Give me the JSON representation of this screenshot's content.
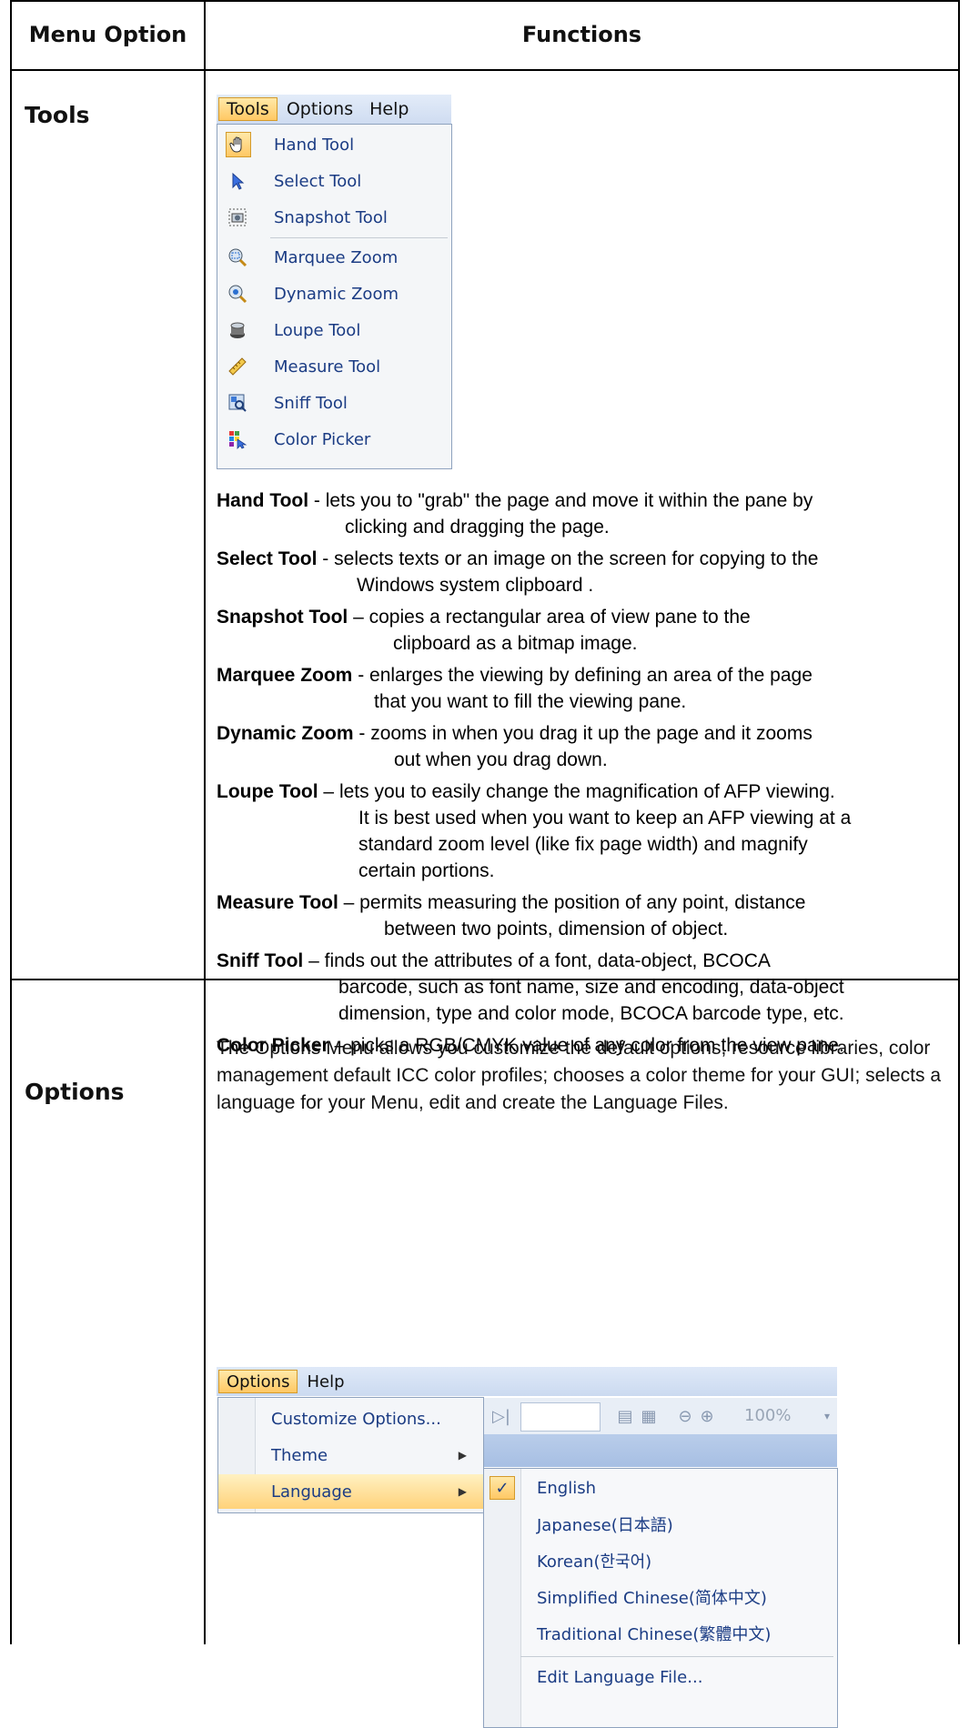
{
  "header": {
    "col1": "Menu Option",
    "col2": "Functions"
  },
  "tools_row": {
    "label": "Tools",
    "menubar": [
      "Tools",
      "Options",
      "Help"
    ],
    "menu_items": [
      {
        "label": "Hand Tool",
        "icon": "hand-icon"
      },
      {
        "label": "Select Tool",
        "icon": "pointer-arrow-icon"
      },
      {
        "label": "Snapshot Tool",
        "icon": "camera-icon"
      },
      {
        "label": "Marquee Zoom",
        "icon": "marquee-zoom-icon"
      },
      {
        "label": "Dynamic Zoom",
        "icon": "dynamic-zoom-icon"
      },
      {
        "label": "Loupe Tool",
        "icon": "loupe-icon"
      },
      {
        "label": "Measure Tool",
        "icon": "ruler-icon"
      },
      {
        "label": "Sniff Tool",
        "icon": "sniff-icon"
      },
      {
        "label": "Color Picker",
        "icon": "color-picker-icon"
      }
    ],
    "descriptions": [
      {
        "term": "Hand Tool",
        "sep": " - ",
        "lines": [
          "lets you to \"grab\" the page and move it within the pane by",
          "clicking and dragging the page."
        ]
      },
      {
        "term": "Select Tool",
        "sep": " - ",
        "lines": [
          "selects texts or an image on the screen for copying to the",
          "Windows system clipboard ."
        ]
      },
      {
        "term": "Snapshot Tool",
        "sep": " – ",
        "lines": [
          "copies a rectangular area of view pane to the",
          "clipboard as a bitmap image."
        ]
      },
      {
        "term": "Marquee Zoom",
        "sep": " - ",
        "lines": [
          "enlarges the viewing by defining an area of the page",
          "that you want to fill the viewing pane."
        ]
      },
      {
        "term": "Dynamic Zoom",
        "sep": " - ",
        "lines": [
          "zooms in when you drag it up the page and it zooms",
          "out when you drag down."
        ]
      },
      {
        "term": "Loupe Tool",
        "sep": " – ",
        "lines": [
          "lets you to easily change the magnification of AFP viewing.",
          "It is best used when you want to keep an AFP viewing at a",
          "standard zoom level (like fix page width) and magnify",
          "certain portions."
        ]
      },
      {
        "term": "Measure Tool",
        "sep": " – ",
        "lines": [
          "permits measuring the position of any point, distance",
          "between two points, dimension of object."
        ]
      },
      {
        "term": "Sniff Tool",
        "sep": " – ",
        "lines": [
          "finds out the attributes of a font, data-object, BCOCA",
          "barcode, such as font name, size and encoding, data-object",
          "dimension, type and color mode, BCOCA barcode type, etc."
        ]
      },
      {
        "term": "Color Picker",
        "sep": " – ",
        "lines": [
          "picks a RGB/CMYK value of any color from the view pane."
        ]
      }
    ]
  },
  "options_row": {
    "label": "Options",
    "paragraph": "The Options Menu allows you customize the default options, resource libraries, color management default ICC color profiles;  chooses a color theme for your GUI; selects a language for your Menu, edit and create the Language Files.",
    "menubar": [
      "Options",
      "Help"
    ],
    "toolbar_zoom": "100%",
    "menu_items": [
      {
        "label": "Customize Options..."
      },
      {
        "label": "Theme"
      },
      {
        "label": "Language"
      }
    ],
    "languages": [
      {
        "label": "English"
      },
      {
        "label": "Japanese(日本語)"
      },
      {
        "label": "Korean(한국어)"
      },
      {
        "label": "Simplified Chinese(简体中文)"
      },
      {
        "label": "Traditional Chinese(繁體中文)"
      },
      {
        "label": "Edit Language File..."
      }
    ]
  }
}
